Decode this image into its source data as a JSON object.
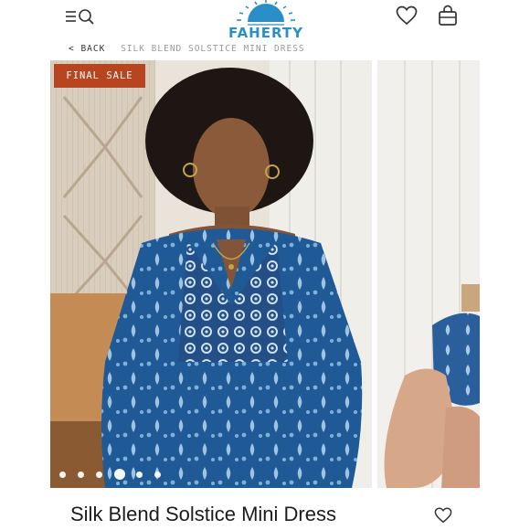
{
  "header": {
    "logo_text": "FAHERTY",
    "menu_icon": "menu-icon",
    "search_icon": "search-icon",
    "wishlist_icon": "heart-icon",
    "bag_icon": "shopping-bag-icon",
    "brand_color": "#2a8fc6"
  },
  "breadcrumb": {
    "back_label": "< BACK",
    "current": "SILK BLEND SOLSTICE MINI DRESS"
  },
  "gallery": {
    "badge": "FINAL SALE",
    "badge_color": "#b8451f",
    "slide_count": 6,
    "active_slide": 4
  },
  "product": {
    "title": "Silk Blend Solstice Mini Dress",
    "favorite_icon": "heart-outline-icon"
  }
}
